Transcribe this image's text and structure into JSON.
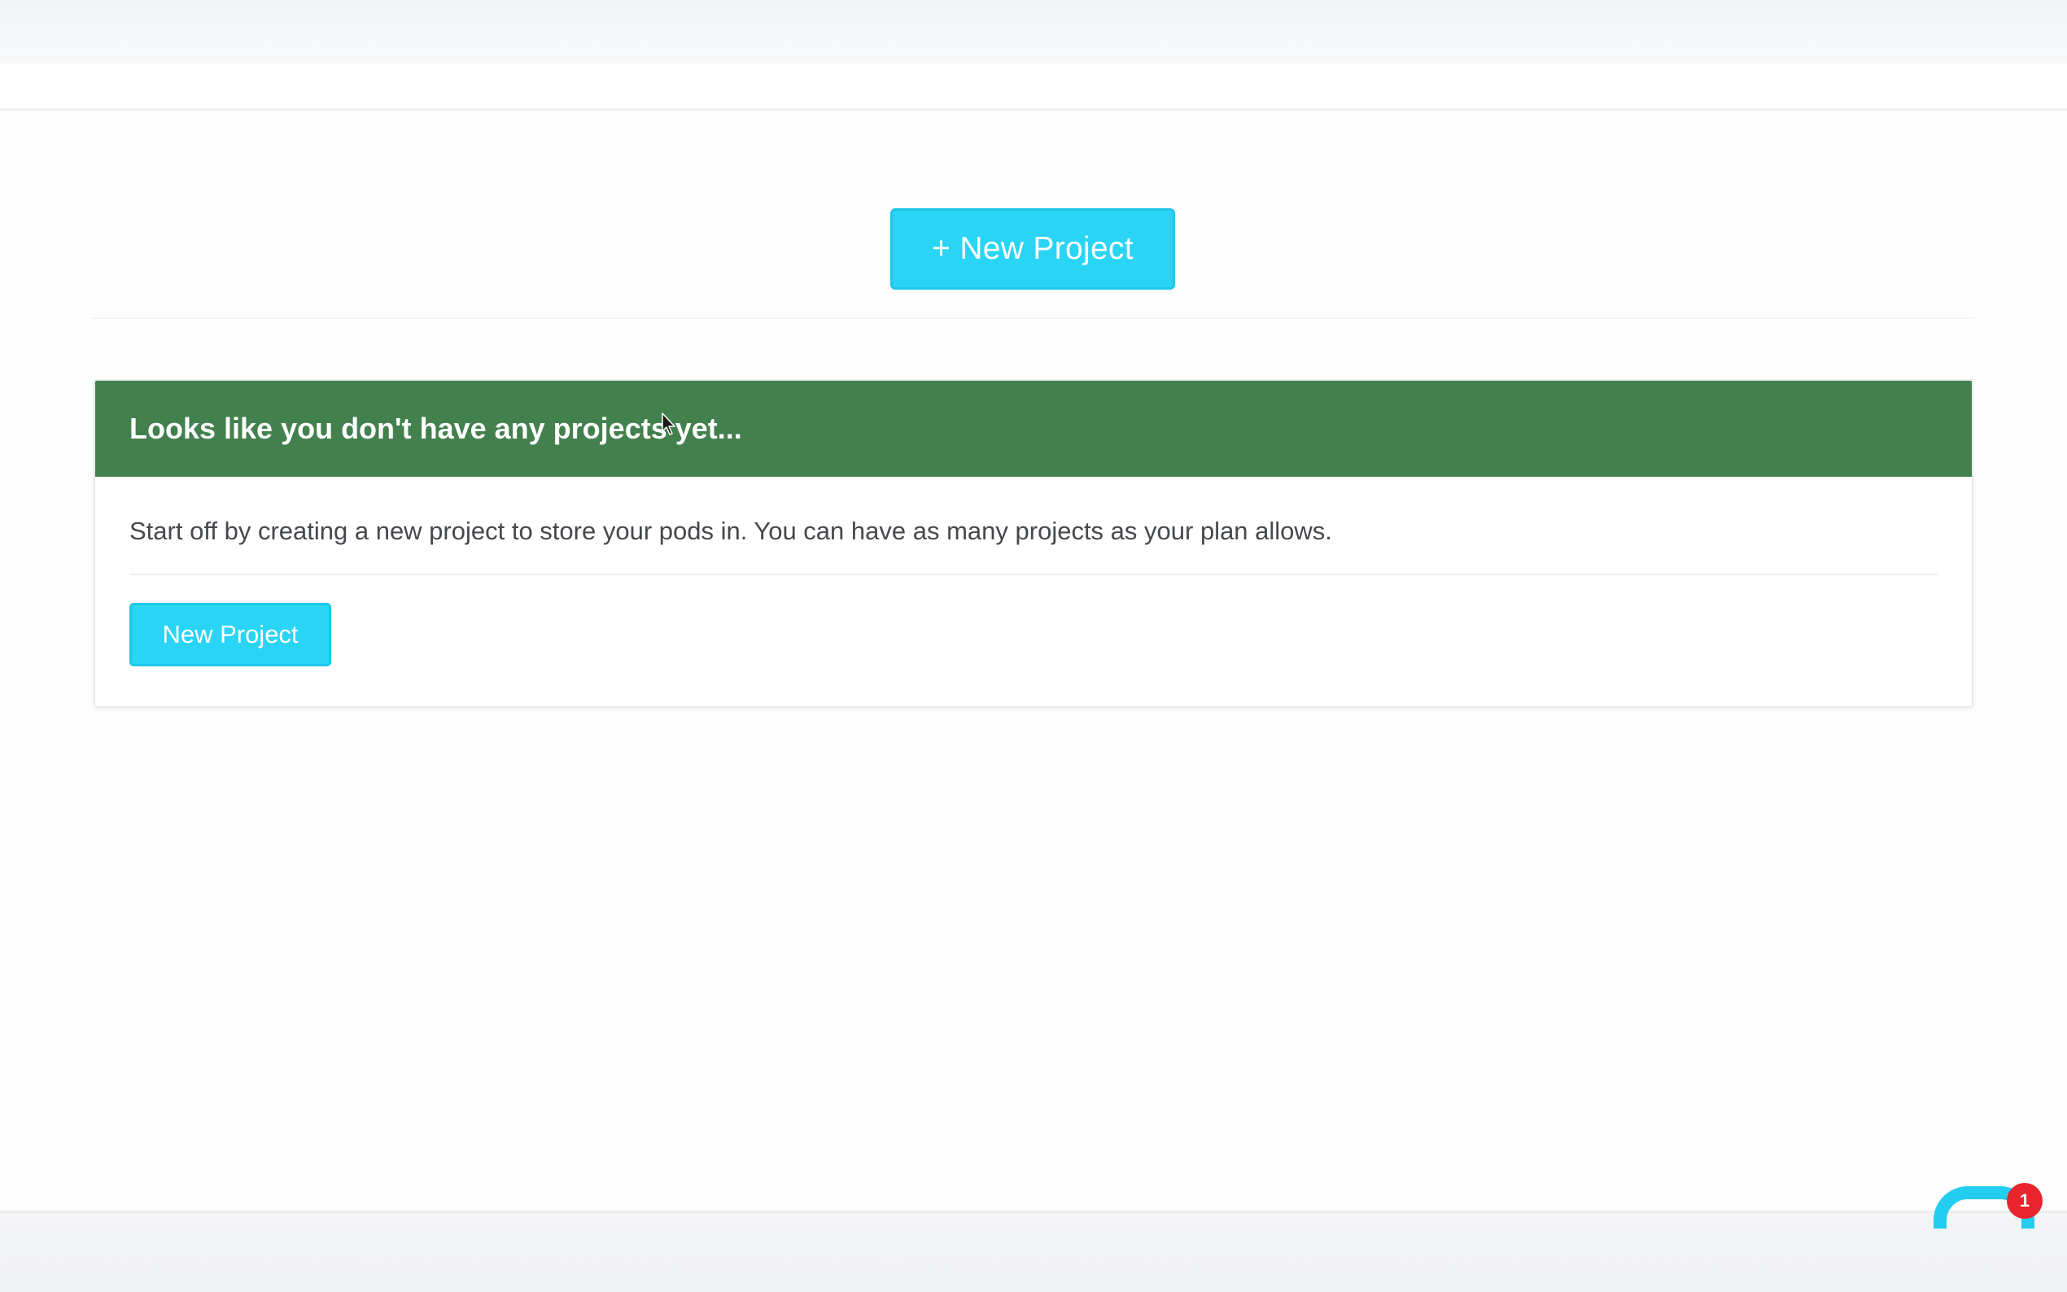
{
  "header": {
    "new_project_button": "+ New Project"
  },
  "empty_state": {
    "title": "Looks like you don't have any projects yet...",
    "description": "Start off by creating a new project to store your pods in. You can have as many projects as your plan allows.",
    "button_label": "New Project"
  },
  "chat": {
    "badge_count": "1"
  },
  "colors": {
    "accent": "#2ad4f4",
    "header_green": "#42804e",
    "badge_red": "#e8242c"
  },
  "icons": {
    "cursor": "mouse-pointer-icon",
    "chat": "chat-bubble-icon"
  }
}
